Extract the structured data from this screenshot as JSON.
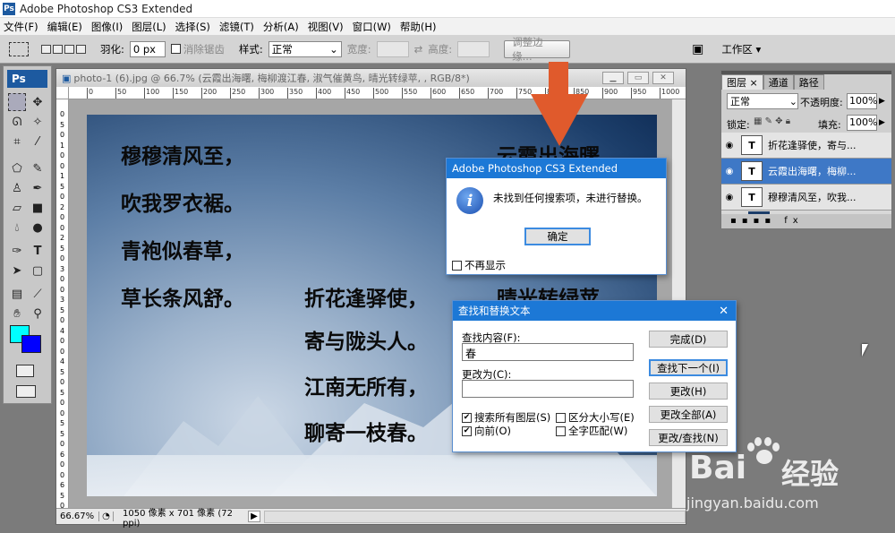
{
  "app": {
    "title": "Adobe Photoshop CS3 Extended",
    "logo": "Ps"
  },
  "menu": [
    "文件(F)",
    "编辑(E)",
    "图像(I)",
    "图层(L)",
    "选择(S)",
    "滤镜(T)",
    "分析(A)",
    "视图(V)",
    "窗口(W)",
    "帮助(H)"
  ],
  "options": {
    "feather_label": "羽化:",
    "feather_value": "0 px",
    "antialias_label": "消除锯齿",
    "style_label": "样式:",
    "style_value": "正常",
    "width_label": "宽度:",
    "height_label": "高度:",
    "refine_edge": "调整边缘...",
    "workspace": "工作区 ▾"
  },
  "document": {
    "title": "photo-1 (6).jpg @ 66.7% (云霞出海曙,  梅柳渡江春,  淑气催黄鸟,  晴光转绿苹,  , RGB/8*)",
    "ruler_h": [
      "0",
      "50",
      "100",
      "150",
      "200",
      "250",
      "300",
      "350",
      "400",
      "450",
      "500",
      "550",
      "600",
      "650",
      "700",
      "750",
      "800",
      "850",
      "900",
      "950",
      "1000",
      "10"
    ],
    "ruler_v": [
      "0",
      "5",
      "0",
      "1",
      "0",
      "0",
      "1",
      "5",
      "0",
      "2",
      "0",
      "0",
      "2",
      "5",
      "0",
      "3",
      "0",
      "0",
      "3",
      "5",
      "0",
      "4",
      "0",
      "0",
      "4",
      "5",
      "0",
      "5",
      "0",
      "0",
      "5",
      "5",
      "0",
      "6",
      "0",
      "0",
      "6",
      "5",
      "0"
    ],
    "poem": {
      "col1": [
        "穆穆清风至，",
        "吹我罗衣裾。",
        "青袍似春草，",
        "草长条风舒。"
      ],
      "col2": [
        "折花逢驿使，",
        "寄与陇头人。",
        "江南无所有，",
        "聊寄一枝春。"
      ],
      "col3_top": "云霞出海曙",
      "col3_bottom": "晴光转绿苹。"
    },
    "zoom": "66.67%",
    "info": "1050 像素 x 701 像素 (72 ppi)"
  },
  "layers_panel": {
    "tabs": [
      "图层 ×",
      "通道",
      "路径"
    ],
    "blend_mode": "正常",
    "opacity_label": "不透明度:",
    "opacity_value": "100%",
    "lock_label": "锁定:",
    "fill_label": "填充:",
    "fill_value": "100%",
    "layers": [
      {
        "name": "折花逢驿使，寄与...",
        "selected": false
      },
      {
        "name": "云霞出海曙，梅柳...",
        "selected": true
      },
      {
        "name": "穆穆清风至，吹我...",
        "selected": false
      }
    ],
    "bottom_text": "▪▪▪▪ fx"
  },
  "alert": {
    "title": "Adobe Photoshop CS3 Extended",
    "message": "未找到任何搜索项，未进行替换。",
    "ok": "确定",
    "dont_show": "不再显示"
  },
  "find_replace": {
    "title": "查找和替换文本",
    "find_label": "查找内容(F):",
    "find_value": "春",
    "replace_label": "更改为(C):",
    "replace_value": "",
    "options": [
      {
        "label": "搜索所有图层(S)",
        "checked": true
      },
      {
        "label": "区分大小写(E)",
        "checked": false
      },
      {
        "label": "向前(O)",
        "checked": true
      },
      {
        "label": "全字匹配(W)",
        "checked": false
      }
    ],
    "buttons": [
      "完成(D)",
      "查找下一个(I)",
      "更改(H)",
      "更改全部(A)",
      "更改/查找(N)"
    ]
  },
  "watermark": {
    "brand": "Bai",
    "brand2": "经验",
    "url": "jingyan.baidu.com"
  },
  "colors": {
    "accent_arrow": "#e05a2c",
    "foreground": "#00ffff",
    "background": "#0000ff",
    "dialog_title": "#1c78d6"
  }
}
